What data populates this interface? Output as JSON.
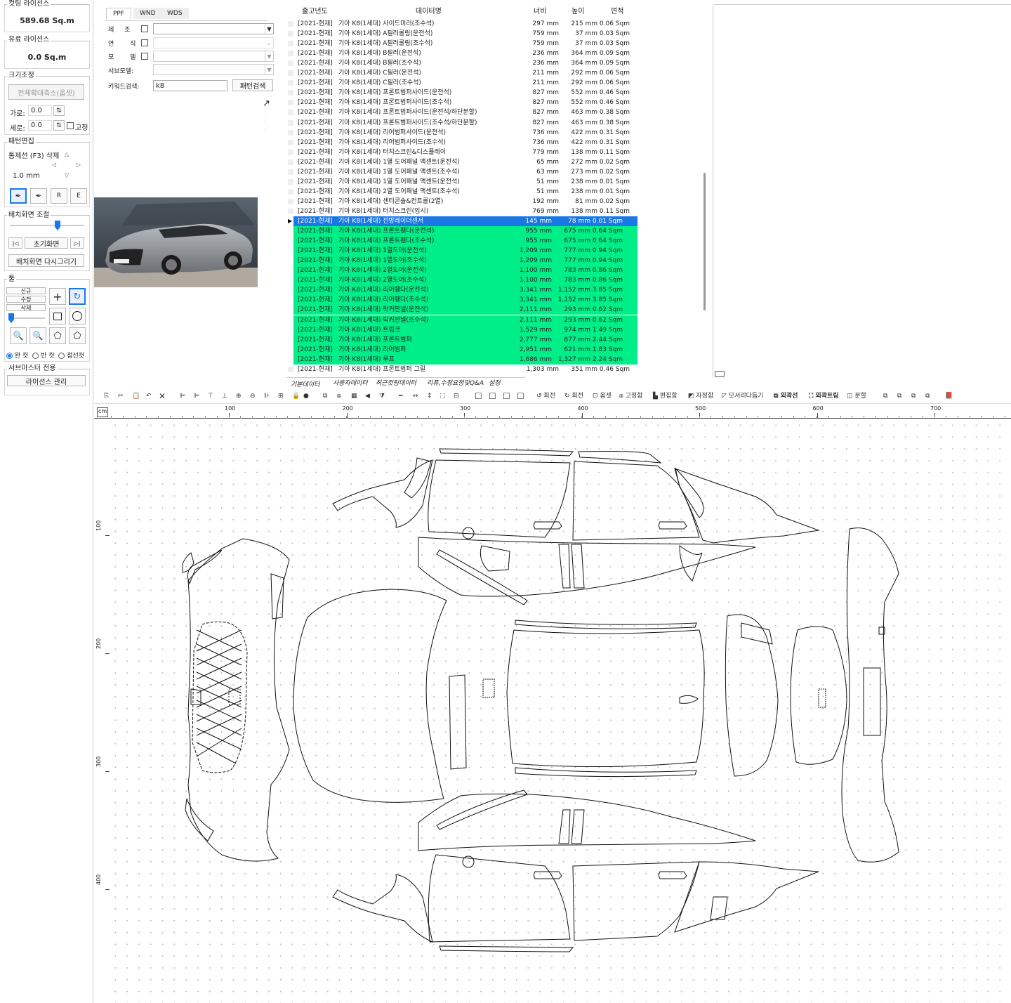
{
  "left_panel": {
    "cutting_license": {
      "label": "컷팅 라이선스",
      "value": "589.68 Sq.m"
    },
    "paid_license": {
      "label": "유료 라이선스",
      "value": "0.0 Sq.m"
    },
    "resize": {
      "label": "크기조정",
      "all_button": "전체확대축소(옵셋)",
      "width_label": "가로:",
      "width_value": "0.0",
      "height_label": "세로:",
      "height_value": "0.0",
      "fix_label": "고정"
    },
    "pattern_edit": {
      "label": "패턴편집",
      "outline_delete": "톰제선 (F3) 삭제",
      "size": "1.0 mm",
      "btn_r": "R",
      "btn_e": "E"
    },
    "layout": {
      "label": "배치화면 조절",
      "reset": "초기화면",
      "redraw": "배치화면 다시그리기"
    },
    "tools": {
      "label": "툴",
      "new": "신규",
      "edit": "수정",
      "delete": "삭제",
      "radio_full": "완 컷",
      "radio_half": "반 컷",
      "radio_dotted": "점선컷"
    },
    "submaster": {
      "label": "서브마스터 전용",
      "license_mgmt": "라이선스 관리"
    }
  },
  "search": {
    "tabs": [
      "PPF",
      "WND",
      "WDS"
    ],
    "maker_label": "제 조 사",
    "year_label": "연 식",
    "model_label": "모 델",
    "submodel_label": "서브모델:",
    "keyword_label": "키워드검색:",
    "keyword_value": "k8",
    "search_button": "패턴검색"
  },
  "grid": {
    "headers": {
      "year": "출고년도",
      "name": "데이터명",
      "width": "너비",
      "height": "높이",
      "area": "면적"
    },
    "rows": [
      {
        "year": "[2021-현재]",
        "name": "기아 K8(1세대) 사이드미러(조수석)",
        "w": "297 mm",
        "h": "215 mm",
        "a": "0.06 Sqm",
        "state": "normal"
      },
      {
        "year": "[2021-현재]",
        "name": "기아 K8(1세대) A필러롤링(운전석)",
        "w": "759 mm",
        "h": "37 mm",
        "a": "0.03 Sqm",
        "state": "normal"
      },
      {
        "year": "[2021-현재]",
        "name": "기아 K8(1세대) A필러롤링(조수석)",
        "w": "759 mm",
        "h": "37 mm",
        "a": "0.03 Sqm",
        "state": "normal"
      },
      {
        "year": "[2021-현재]",
        "name": "기아 K8(1세대) B필러(운전석)",
        "w": "236 mm",
        "h": "364 mm",
        "a": "0.09 Sqm",
        "state": "normal"
      },
      {
        "year": "[2021-현재]",
        "name": "기아 K8(1세대) B필러(조수석)",
        "w": "236 mm",
        "h": "364 mm",
        "a": "0.09 Sqm",
        "state": "normal"
      },
      {
        "year": "[2021-현재]",
        "name": "기아 K8(1세대) C필러(운전석)",
        "w": "211 mm",
        "h": "292 mm",
        "a": "0.06 Sqm",
        "state": "normal"
      },
      {
        "year": "[2021-현재]",
        "name": "기아 K8(1세대) C필러(조수석)",
        "w": "211 mm",
        "h": "292 mm",
        "a": "0.06 Sqm",
        "state": "normal"
      },
      {
        "year": "[2021-현재]",
        "name": "기아 K8(1세대) 프론트범퍼사이드(운전석)",
        "w": "827 mm",
        "h": "552 mm",
        "a": "0.46 Sqm",
        "state": "normal"
      },
      {
        "year": "[2021-현재]",
        "name": "기아 K8(1세대) 프론트범퍼사이드(조수석)",
        "w": "827 mm",
        "h": "552 mm",
        "a": "0.46 Sqm",
        "state": "normal"
      },
      {
        "year": "[2021-현재]",
        "name": "기아 K8(1세대) 프론트범퍼사이드(운전석/하단분할)",
        "w": "827 mm",
        "h": "463 mm",
        "a": "0.38 Sqm",
        "state": "normal"
      },
      {
        "year": "[2021-현재]",
        "name": "기아 K8(1세대) 프론트범퍼사이드(조수석/하단분할)",
        "w": "827 mm",
        "h": "463 mm",
        "a": "0.38 Sqm",
        "state": "normal"
      },
      {
        "year": "[2021-현재]",
        "name": "기아 K8(1세대) 리어범퍼사이드(운전석)",
        "w": "736 mm",
        "h": "422 mm",
        "a": "0.31 Sqm",
        "state": "normal"
      },
      {
        "year": "[2021-현재]",
        "name": "기아 K8(1세대) 리어범퍼사이드(조수석)",
        "w": "736 mm",
        "h": "422 mm",
        "a": "0.31 Sqm",
        "state": "normal"
      },
      {
        "year": "[2021-현재]",
        "name": "기아 K8(1세대) 터치스크린&디스플레이",
        "w": "779 mm",
        "h": "138 mm",
        "a": "0.11 Sqm",
        "state": "normal"
      },
      {
        "year": "[2021-현재]",
        "name": "기아 K8(1세대) 1열 도어패널 액센트(운전석)",
        "w": "65 mm",
        "h": "272 mm",
        "a": "0.02 Sqm",
        "state": "normal"
      },
      {
        "year": "[2021-현재]",
        "name": "기아 K8(1세대) 1열 도어패널 액센트(조수석)",
        "w": "63 mm",
        "h": "273 mm",
        "a": "0.02 Sqm",
        "state": "normal"
      },
      {
        "year": "[2021-현재]",
        "name": "기아 K8(1세대) 1열 도어패널 액센트(운전석)",
        "w": "51 mm",
        "h": "238 mm",
        "a": "0.01 Sqm",
        "state": "normal"
      },
      {
        "year": "[2021-현재]",
        "name": "기아 K8(1세대) 2열 도어패널 액센트(조수석)",
        "w": "51 mm",
        "h": "238 mm",
        "a": "0.01 Sqm",
        "state": "normal"
      },
      {
        "year": "[2021-현재]",
        "name": "기아 K8(1세대) 센터콘솔&컨트롤(2열)",
        "w": "192 mm",
        "h": "81 mm",
        "a": "0.02 Sqm",
        "state": "normal"
      },
      {
        "year": "[2021-현재]",
        "name": "기아 K8(1세대) 터치스크린(임시)",
        "w": "769 mm",
        "h": "138 mm",
        "a": "0.11 Sqm",
        "state": "normal"
      },
      {
        "year": "[2021-현재]",
        "name": "기아 K8(1세대) 전방레이더센서",
        "w": "145 mm",
        "h": "78 mm",
        "a": "0.01 Sqm",
        "state": "selected"
      },
      {
        "year": "[2021-현재]",
        "name": "기아 K8(1세대) 프론트휀다(운전석)",
        "w": "955 mm",
        "h": "675 mm",
        "a": "0.64 Sqm",
        "state": "hl"
      },
      {
        "year": "[2021-현재]",
        "name": "기아 K8(1세대) 프론트휀다(조수석)",
        "w": "955 mm",
        "h": "675 mm",
        "a": "0.64 Sqm",
        "state": "hl"
      },
      {
        "year": "[2021-현재]",
        "name": "기아 K8(1세대) 1열도어(운전석)",
        "w": "1,209 mm",
        "h": "777 mm",
        "a": "0.94 Sqm",
        "state": "hl"
      },
      {
        "year": "[2021-현재]",
        "name": "기아 K8(1세대) 1열도어(조수석)",
        "w": "1,209 mm",
        "h": "777 mm",
        "a": "0.94 Sqm",
        "state": "hl"
      },
      {
        "year": "[2021-현재]",
        "name": "기아 K8(1세대) 2열도어(운전석)",
        "w": "1,100 mm",
        "h": "783 mm",
        "a": "0.86 Sqm",
        "state": "hl"
      },
      {
        "year": "[2021-현재]",
        "name": "기아 K8(1세대) 2열도어(조수석)",
        "w": "1,100 mm",
        "h": "783 mm",
        "a": "0.86 Sqm",
        "state": "hl"
      },
      {
        "year": "[2021-현재]",
        "name": "기아 K8(1세대) 리어휀다(운전석)",
        "w": "3,341 mm",
        "h": "1,152 mm",
        "a": "3.85 Sqm",
        "state": "hl"
      },
      {
        "year": "[2021-현재]",
        "name": "기아 K8(1세대) 리어휀다(조수석)",
        "w": "3,341 mm",
        "h": "1,152 mm",
        "a": "3.85 Sqm",
        "state": "hl"
      },
      {
        "year": "[2021-현재]",
        "name": "기아 K8(1세대) 락커판넬(운전석)",
        "w": "2,111 mm",
        "h": "293 mm",
        "a": "0.62 Sqm",
        "state": "hl"
      },
      {
        "year": "[2021-현재]",
        "name": "기아 K8(1세대) 락커판넬(조수석)",
        "w": "2,111 mm",
        "h": "293 mm",
        "a": "0.62 Sqm",
        "state": "hl"
      },
      {
        "year": "[2021-현재]",
        "name": "기아 K8(1세대) 트렁크",
        "w": "1,529 mm",
        "h": "974 mm",
        "a": "1.49 Sqm",
        "state": "hl"
      },
      {
        "year": "[2021-현재]",
        "name": "기아 K8(1세대) 프론트범퍼",
        "w": "2,777 mm",
        "h": "877 mm",
        "a": "2.44 Sqm",
        "state": "hl"
      },
      {
        "year": "[2021-현재]",
        "name": "기아 K8(1세대) 리어범퍼",
        "w": "2,951 mm",
        "h": "621 mm",
        "a": "1.83 Sqm",
        "state": "hl"
      },
      {
        "year": "[2021-현재]",
        "name": "기아 K8(1세대) 루프",
        "w": "1,686 mm",
        "h": "1,327 mm",
        "a": "2.24 Sqm",
        "state": "hl"
      },
      {
        "year": "[2021-현재]",
        "name": "기아 K8(1세대) 프론트범퍼 그릴",
        "w": "1,303 mm",
        "h": "351 mm",
        "a": "0.46 Sqm",
        "state": "normal"
      }
    ]
  },
  "bottom_tabs": [
    "기본데이터",
    "사용자데이터",
    "최근컷팅데이터",
    "리퓨,수정요청및Q&A",
    "설정"
  ],
  "toolbar": {
    "rotate_ccw": "회전",
    "rotate_cw": "회전",
    "offset": "옵셋",
    "fix": "고정함",
    "edit_all": "편집함",
    "self_edit": "자정함",
    "corner": "모서리다듬기",
    "outline": "외곽선",
    "outline_edit": "외곽트림",
    "split": "분할"
  },
  "ruler": {
    "unit": "cm",
    "top_ticks": [
      "100",
      "200",
      "300",
      "400",
      "500",
      "600",
      "700"
    ],
    "left_ticks": [
      "100",
      "200",
      "300",
      "400"
    ]
  },
  "colors": {
    "selected": "#1a78e6",
    "highlight": "#00ee88",
    "accent_blue": "#1a78e6"
  }
}
